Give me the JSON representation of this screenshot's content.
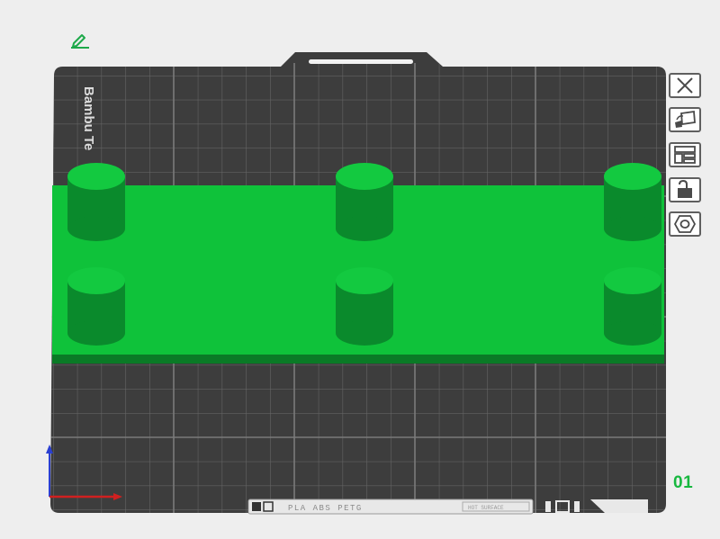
{
  "plate": {
    "brand_label": "Bambu Te",
    "material_label": "PLA ABS PETG",
    "number": "01",
    "info_label": "HOT SURFACE"
  },
  "colors": {
    "background": "#eeeeee",
    "bed": "#3d3d3d",
    "grid": "#6a6a6a",
    "model": "#0fc23a",
    "model_dark": "#0a7a26",
    "accent": "#17b83f"
  },
  "toolbar": {
    "buttons": [
      {
        "name": "close-plate-button",
        "icon": "close-icon"
      },
      {
        "name": "orient-button",
        "icon": "orient-icon"
      },
      {
        "name": "arrange-button",
        "icon": "arrange-icon"
      },
      {
        "name": "lock-button",
        "icon": "lock-icon"
      },
      {
        "name": "settings-button",
        "icon": "gear-icon"
      }
    ]
  },
  "icons": {
    "edit": "pencil-icon"
  }
}
